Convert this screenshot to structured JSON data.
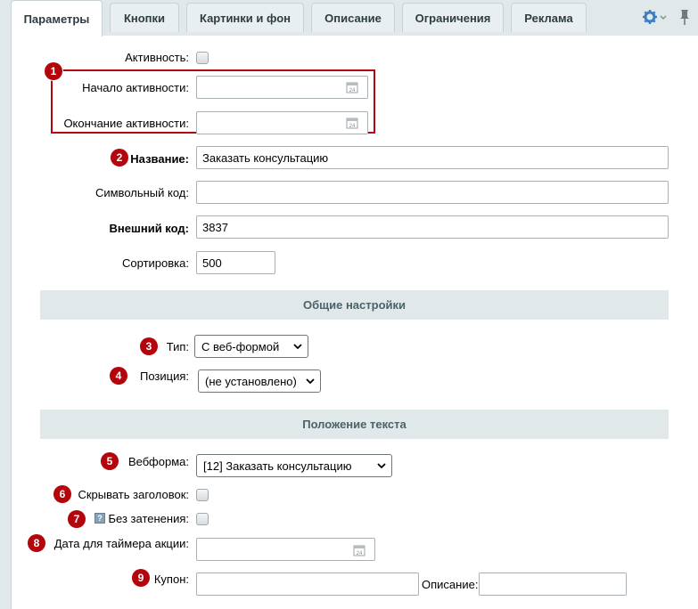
{
  "tabs": [
    "Параметры",
    "Кнопки",
    "Картинки и фон",
    "Описание",
    "Ограничения",
    "Реклама"
  ],
  "fields": {
    "active_label": "Активность:",
    "start_label": "Начало активности:",
    "end_label": "Окончание активности:",
    "name_label": "Название:",
    "name_value": "Заказать консультацию",
    "code_label": "Символьный код:",
    "code_value": "",
    "ext_label": "Внешний код:",
    "ext_value": "3837",
    "sort_label": "Сортировка:",
    "sort_value": "500"
  },
  "general": {
    "title": "Общие настройки",
    "type_label": "Тип:",
    "type_value": "С веб-формой",
    "position_label": "Позиция:",
    "position_value": "(не установлено)"
  },
  "text_pos": {
    "title": "Положение текста",
    "webform_label": "Вебформа:",
    "webform_value": "[12] Заказать консультацию",
    "hide_title_label": "Скрывать заголовок:",
    "no_shade_label": "Без затенения:",
    "timer_label": "Дата для таймера акции:",
    "coupon_label": "Купон:",
    "desc_label": "Описание:"
  },
  "badges": [
    "1",
    "2",
    "3",
    "4",
    "5",
    "6",
    "7",
    "8",
    "9"
  ],
  "colors": {
    "badge": "#b3050b",
    "section_bg": "#e0e8ea",
    "gear": "#3a7fc4"
  },
  "icons": {
    "calendar": "calendar-icon",
    "gear": "gear-icon",
    "pin": "pin-icon",
    "help": "help-icon"
  }
}
